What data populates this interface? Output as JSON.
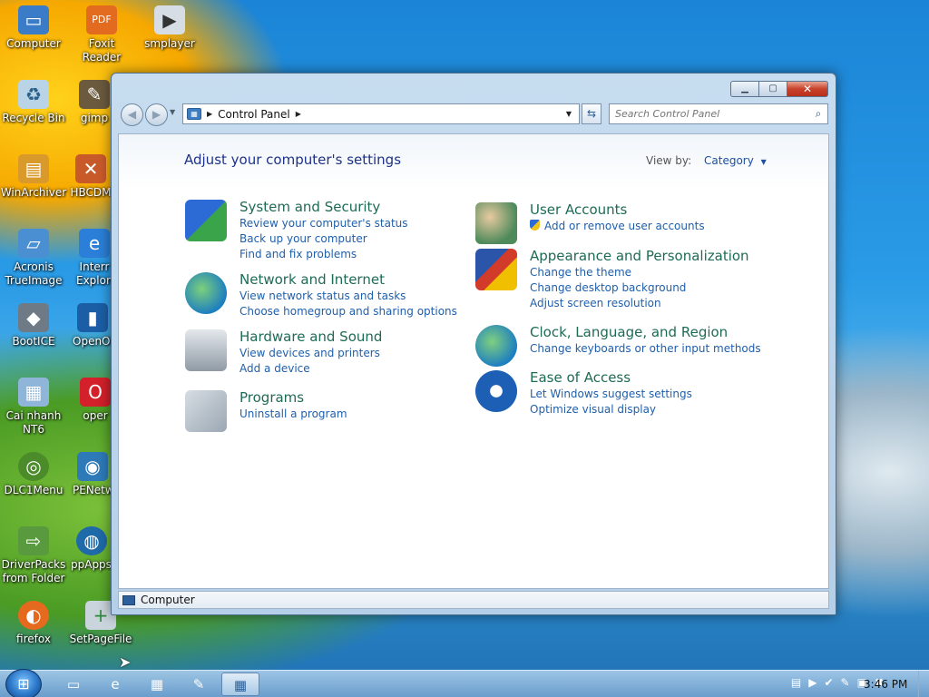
{
  "desktop": {
    "icons": [
      {
        "label": "Computer",
        "icon": "computer-icon"
      },
      {
        "label": "Foxit Reader",
        "icon": "pdf-icon"
      },
      {
        "label": "smplayer",
        "icon": "media-player-icon"
      },
      {
        "label": "Recycle Bin",
        "icon": "recycle-bin-icon"
      },
      {
        "label": "gimp",
        "icon": "gimp-icon"
      },
      {
        "label": "WinArchiver",
        "icon": "archive-icon"
      },
      {
        "label": "HBCDM",
        "icon": "tools-icon"
      },
      {
        "label": "Acronis\nTrueImage",
        "icon": "backup-icon"
      },
      {
        "label": "Interr\nExplore",
        "icon": "internet-explorer-icon"
      },
      {
        "label": "BootICE",
        "icon": "boot-icon"
      },
      {
        "label": "OpenOf",
        "icon": "office-icon"
      },
      {
        "label": "Cai nhanh\nNT6",
        "icon": "installer-icon"
      },
      {
        "label": "oper",
        "icon": "opera-icon"
      },
      {
        "label": "DLC1Menu",
        "icon": "menu-icon"
      },
      {
        "label": "PENetw",
        "icon": "network-icon"
      },
      {
        "label": "DriverPacks\nfrom Folder",
        "icon": "driver-icon"
      },
      {
        "label": "ppAppsV",
        "icon": "apps-icon"
      },
      {
        "label": "firefox",
        "icon": "firefox-icon"
      },
      {
        "label": "SetPageFile",
        "icon": "pagefile-icon"
      }
    ]
  },
  "window": {
    "address": {
      "crumb": "Control Panel"
    },
    "search": {
      "placeholder": "Search Control Panel"
    },
    "page_title": "Adjust your computer's settings",
    "view_by": {
      "label": "View by:",
      "value": "Category"
    },
    "categories": [
      {
        "title": "System and Security",
        "icon": "shield-icon",
        "links": [
          "Review your computer's status",
          "Back up your computer",
          "Find and fix problems"
        ]
      },
      {
        "title": "Network and Internet",
        "icon": "network-globe-icon",
        "links": [
          "View network status and tasks",
          "Choose homegroup and sharing options"
        ]
      },
      {
        "title": "Hardware and Sound",
        "icon": "printer-icon",
        "links": [
          "View devices and printers",
          "Add a device"
        ]
      },
      {
        "title": "Programs",
        "icon": "programs-icon",
        "links": [
          "Uninstall a program"
        ]
      },
      {
        "title": "User Accounts",
        "icon": "users-icon",
        "links": [
          "Add or remove user accounts"
        ]
      },
      {
        "title": "Appearance and Personalization",
        "icon": "display-icon",
        "links": [
          "Change the theme",
          "Change desktop background",
          "Adjust screen resolution"
        ]
      },
      {
        "title": "Clock, Language, and Region",
        "icon": "clock-globe-icon",
        "links": [
          "Change keyboards or other input methods"
        ]
      },
      {
        "title": "Ease of Access",
        "icon": "ease-of-access-icon",
        "links": [
          "Let Windows suggest settings",
          "Optimize visual display"
        ]
      }
    ],
    "status": "Computer"
  },
  "taskbar": {
    "clock": "3:46 PM"
  },
  "colors": {
    "title_blue": "#1e3287",
    "category_green": "#1e6b55",
    "link_blue": "#1e5fad"
  }
}
